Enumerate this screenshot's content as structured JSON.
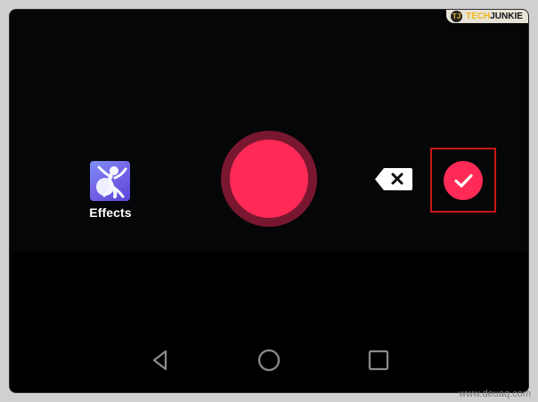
{
  "window": {
    "watermark": {
      "badge": "TJ",
      "tech": "TECH",
      "junkie": "JUNKIE"
    }
  },
  "camera": {
    "effects_label": "Effects",
    "record_button_label": "",
    "delete_icon": "backspace-x-icon",
    "confirm_icon": "check-icon"
  },
  "navigation": {
    "back_icon": "triangle-back-icon",
    "home_icon": "circle-home-icon",
    "recent_icon": "square-recents-icon"
  },
  "footer": {
    "source": "www.deuaq.com"
  },
  "colors": {
    "record_red": "#ff2a56",
    "record_ring": "#7a1730",
    "highlight_red": "#c81717",
    "nav_gray": "#8a8a8a"
  }
}
